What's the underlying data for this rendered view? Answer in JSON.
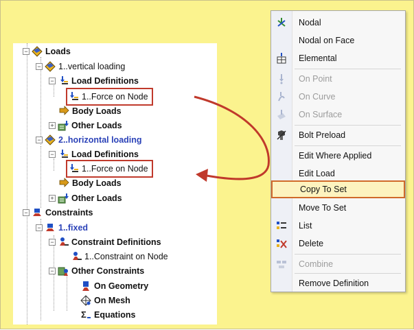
{
  "tree": {
    "loads": "Loads",
    "vertical_loading": "1..vertical loading",
    "load_definitions_1": "Load Definitions",
    "force_on_node_1": "1..Force on Node",
    "body_loads_1": "Body Loads",
    "other_loads_1": "Other Loads",
    "horizontal_loading": "2..horizontal loading",
    "load_definitions_2": "Load Definitions",
    "force_on_node_2": "1..Force on Node",
    "body_loads_2": "Body Loads",
    "other_loads_2": "Other Loads",
    "constraints": "Constraints",
    "fixed": "1..fixed",
    "constraint_definitions": "Constraint Definitions",
    "constraint_on_node": "1..Constraint on Node",
    "other_constraints": "Other Constraints",
    "on_geometry": "On Geometry",
    "on_mesh": "On Mesh",
    "equations": "Equations"
  },
  "menu": {
    "nodal": "Nodal",
    "nodal_on_face": "Nodal on Face",
    "elemental": "Elemental",
    "on_point": "On Point",
    "on_curve": "On Curve",
    "on_surface": "On Surface",
    "bolt_preload": "Bolt Preload",
    "edit_where_applied": "Edit Where Applied",
    "edit_load": "Edit Load",
    "copy_to_set": "Copy To Set",
    "move_to_set": "Move To Set",
    "list": "List",
    "delete": "Delete",
    "combine": "Combine",
    "remove_definition": "Remove Definition"
  },
  "colors": {
    "background": "#fbf38e",
    "highlight_border": "#c0392b",
    "arrow": "#c0392b",
    "tree_blue": "#2c43b8",
    "menu_selected_bg": "#fdf3bf"
  }
}
